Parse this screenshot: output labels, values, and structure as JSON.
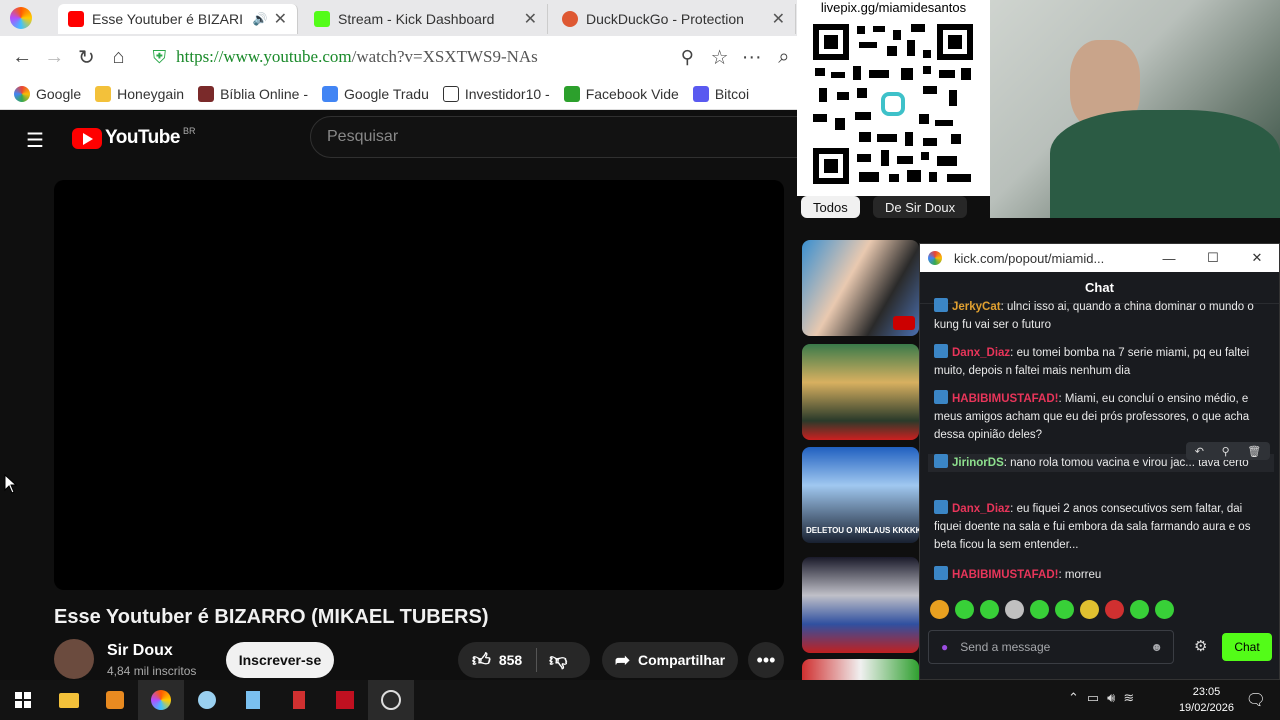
{
  "browser": {
    "tabs": [
      {
        "title": "Esse Youtuber é BIZARI",
        "color": "#ff0000"
      },
      {
        "title": "Stream - Kick Dashboard",
        "color": "#53fc18"
      },
      {
        "title": "DuckDuckGo - Protection",
        "color": "#de5833"
      }
    ],
    "url_host": "https://www.youtube.com",
    "url_path": "/watch?v=XSXTWS9-NAs",
    "bookmarks": [
      "Google",
      "Honeygain",
      "Bíblia Online -",
      "Google Tradu",
      "Investidor10 -",
      "Facebook Vide",
      "Bitcoi"
    ]
  },
  "youtube": {
    "logo": "YouTube",
    "region": "BR",
    "search_placeholder": "Pesquisar",
    "video_title": "Esse Youtuber é BIZARRO (MIKAEL TUBERS)",
    "channel_name": "Sir Doux",
    "subscribers": "4,84 mil inscritos",
    "subscribe_label": "Inscrever-se",
    "likes": "858",
    "share_label": "Compartilhar",
    "chips": [
      "Todos",
      "De Sir Doux"
    ],
    "thumb_caption": "DELETOU O NIKLAUS KKKKKKK"
  },
  "overlay": {
    "qr_url": "livepix.gg/miamidesantos"
  },
  "chat": {
    "window_title": "kick.com/popout/miamid...",
    "header": "Chat",
    "messages": [
      {
        "user": "JerkyCat",
        "color": "#e0a030",
        "text": "ulnci isso ai, quando a china dominar o mundo o kung fu vai ser o futuro"
      },
      {
        "user": "Danx_Diaz",
        "color": "#e8355a",
        "text": "eu tomei bomba na 7 serie miami, pq eu faltei muito, depois n faltei mais nenhum dia"
      },
      {
        "user": "HABIBIMUSTAFAD!",
        "color": "#e8355a",
        "text": "Miami, eu concluí o ensino médio, e meus amigos acham que eu dei prós professores, o que acha dessa opinião deles?"
      },
      {
        "user": "JirinorDS",
        "color": "#8ee08e",
        "text": "nano rola tomou vacina e virou jac... tava certo"
      },
      {
        "user": "Danx_Diaz",
        "color": "#e8355a",
        "text": "eu fiquei 2 anos consecutivos sem faltar, dai fiquei doente na sala e fui embora da sala farmando aura e os beta ficou la sem entender..."
      },
      {
        "user": "HABIBIMUSTAFAD!",
        "color": "#e8355a",
        "text": "morreu"
      }
    ],
    "input_placeholder": "Send a message",
    "send_label": "Chat"
  },
  "taskbar": {
    "time": "23:05",
    "date": "19/02/2026"
  }
}
